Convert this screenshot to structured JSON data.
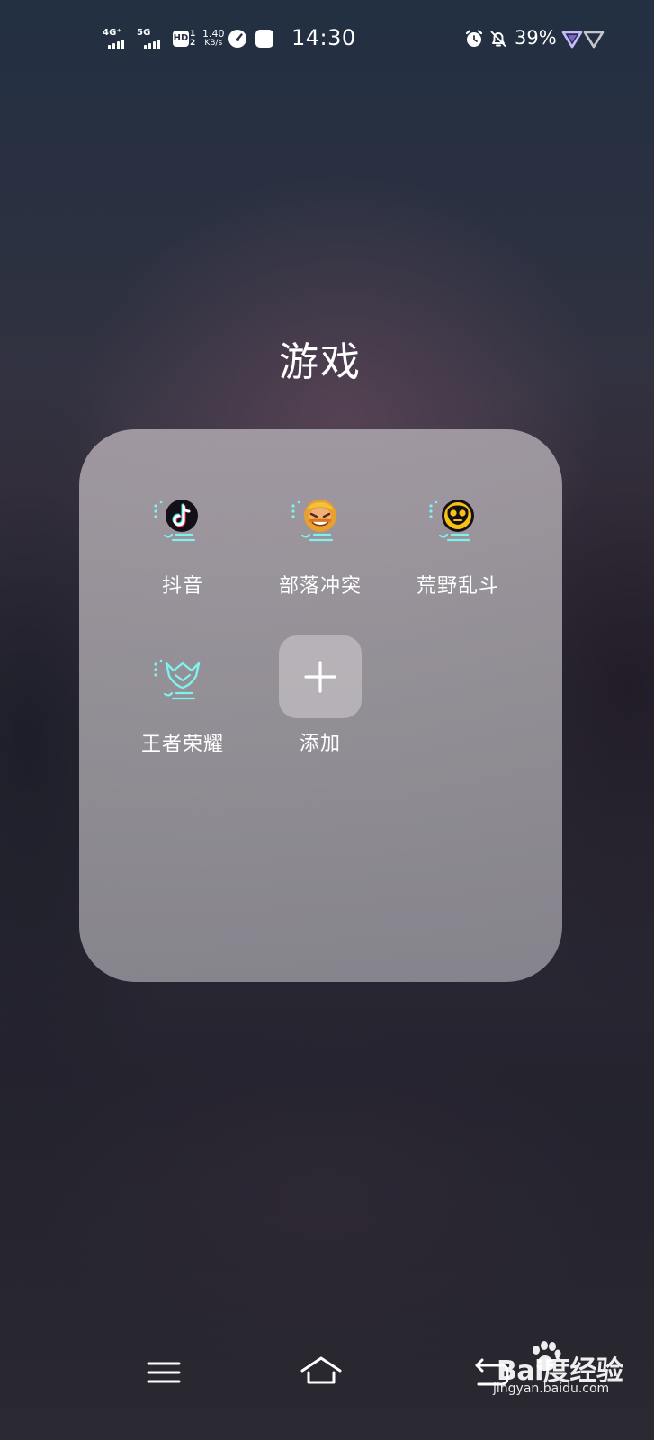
{
  "status_bar": {
    "sim1_network": "4G⁺",
    "sim2_network": "5G",
    "hd_label": "HD",
    "hd_sub_top": "1",
    "hd_sub_bottom": "2",
    "speed_value": "1.40",
    "speed_unit": "KB/s",
    "time": "14:30",
    "battery": "39%",
    "icons": [
      "signal-bars-icon",
      "hd-voice-icon",
      "speedometer-icon",
      "square-app-icon",
      "alarm-clock-icon",
      "bell-muted-icon",
      "vpn-triangle-icon"
    ]
  },
  "folder": {
    "title": "游戏",
    "apps": [
      {
        "label": "抖音",
        "icon": "douyin-icon"
      },
      {
        "label": "部落冲突",
        "icon": "clash-of-clans-icon"
      },
      {
        "label": "荒野乱斗",
        "icon": "brawl-stars-icon"
      },
      {
        "label": "王者荣耀",
        "icon": "honor-of-kings-icon"
      }
    ],
    "add": {
      "label": "添加",
      "icon": "plus-icon"
    }
  },
  "nav_bar": {
    "icons": [
      "menu-icon",
      "home-icon",
      "back-icon"
    ]
  },
  "watermark": {
    "brand": "Bai度经验",
    "site": "jingyan.baidu.com"
  },
  "colors": {
    "glow_cyan": "#7ff2ee",
    "douyin_dark": "#141018",
    "douyin_cyan": "#25f4ee",
    "douyin_pink": "#fe2c55",
    "brawl_yellow": "#f6c315",
    "coc_orange": "#e8a02e"
  }
}
